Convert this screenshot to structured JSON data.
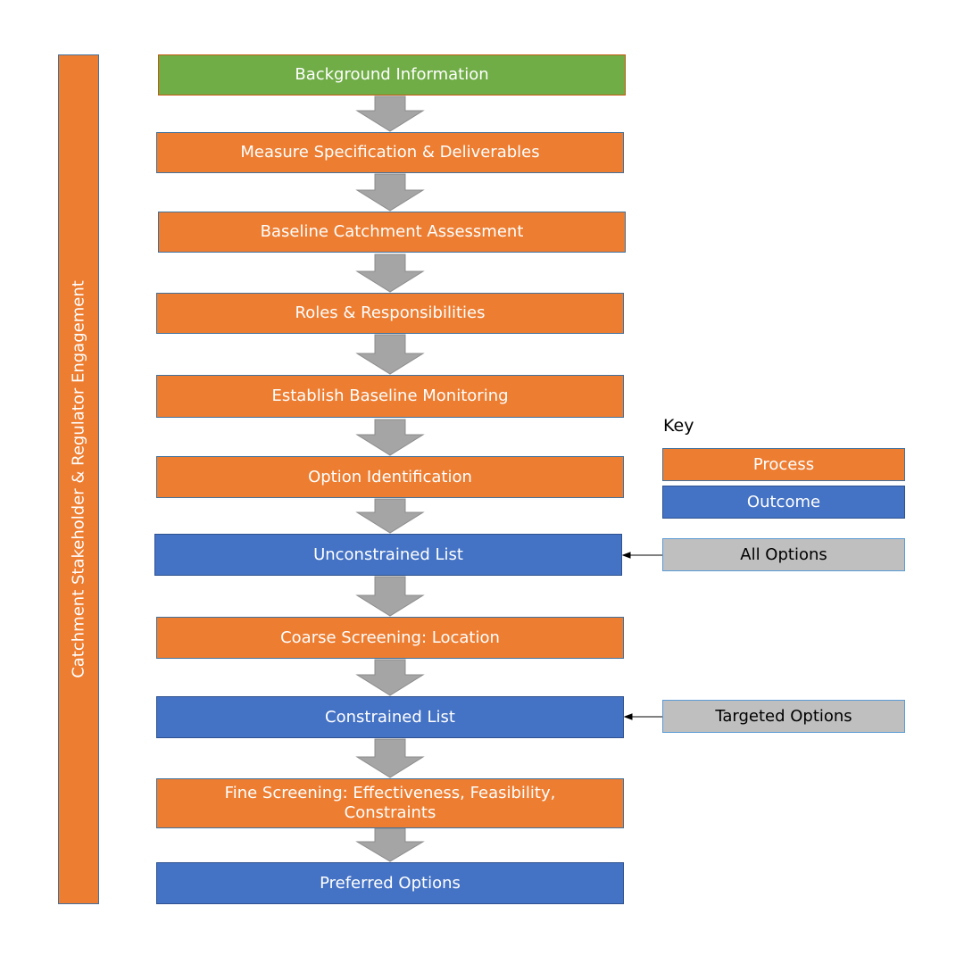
{
  "side_label": "Catchment Stakeholder & Regulator Engagement",
  "steps": [
    {
      "label": "Background Information",
      "type": "background"
    },
    {
      "label": "Measure Specification & Deliverables",
      "type": "process"
    },
    {
      "label": "Baseline Catchment Assessment",
      "type": "process"
    },
    {
      "label": "Roles & Responsibilities",
      "type": "process"
    },
    {
      "label": "Establish Baseline Monitoring",
      "type": "process"
    },
    {
      "label": "Option Identification",
      "type": "process"
    },
    {
      "label": "Unconstrained List",
      "type": "outcome"
    },
    {
      "label": "Coarse Screening: Location",
      "type": "process"
    },
    {
      "label": "Constrained List",
      "type": "outcome"
    },
    {
      "label": "Fine Screening: Effectiveness, Feasibility, Constraints",
      "type": "process"
    },
    {
      "label": "Preferred Options",
      "type": "outcome"
    }
  ],
  "key": {
    "title": "Key",
    "process": "Process",
    "outcome": "Outcome"
  },
  "annotations": [
    {
      "label": "All Options",
      "points_to": "Unconstrained List"
    },
    {
      "label": "Targeted Options",
      "points_to": "Constrained List"
    }
  ],
  "colors": {
    "process": "#ED7D31",
    "outcome": "#4472C4",
    "background": "#70AD47",
    "annotation": "#BFBFBF",
    "arrow": "#A5A5A5"
  }
}
